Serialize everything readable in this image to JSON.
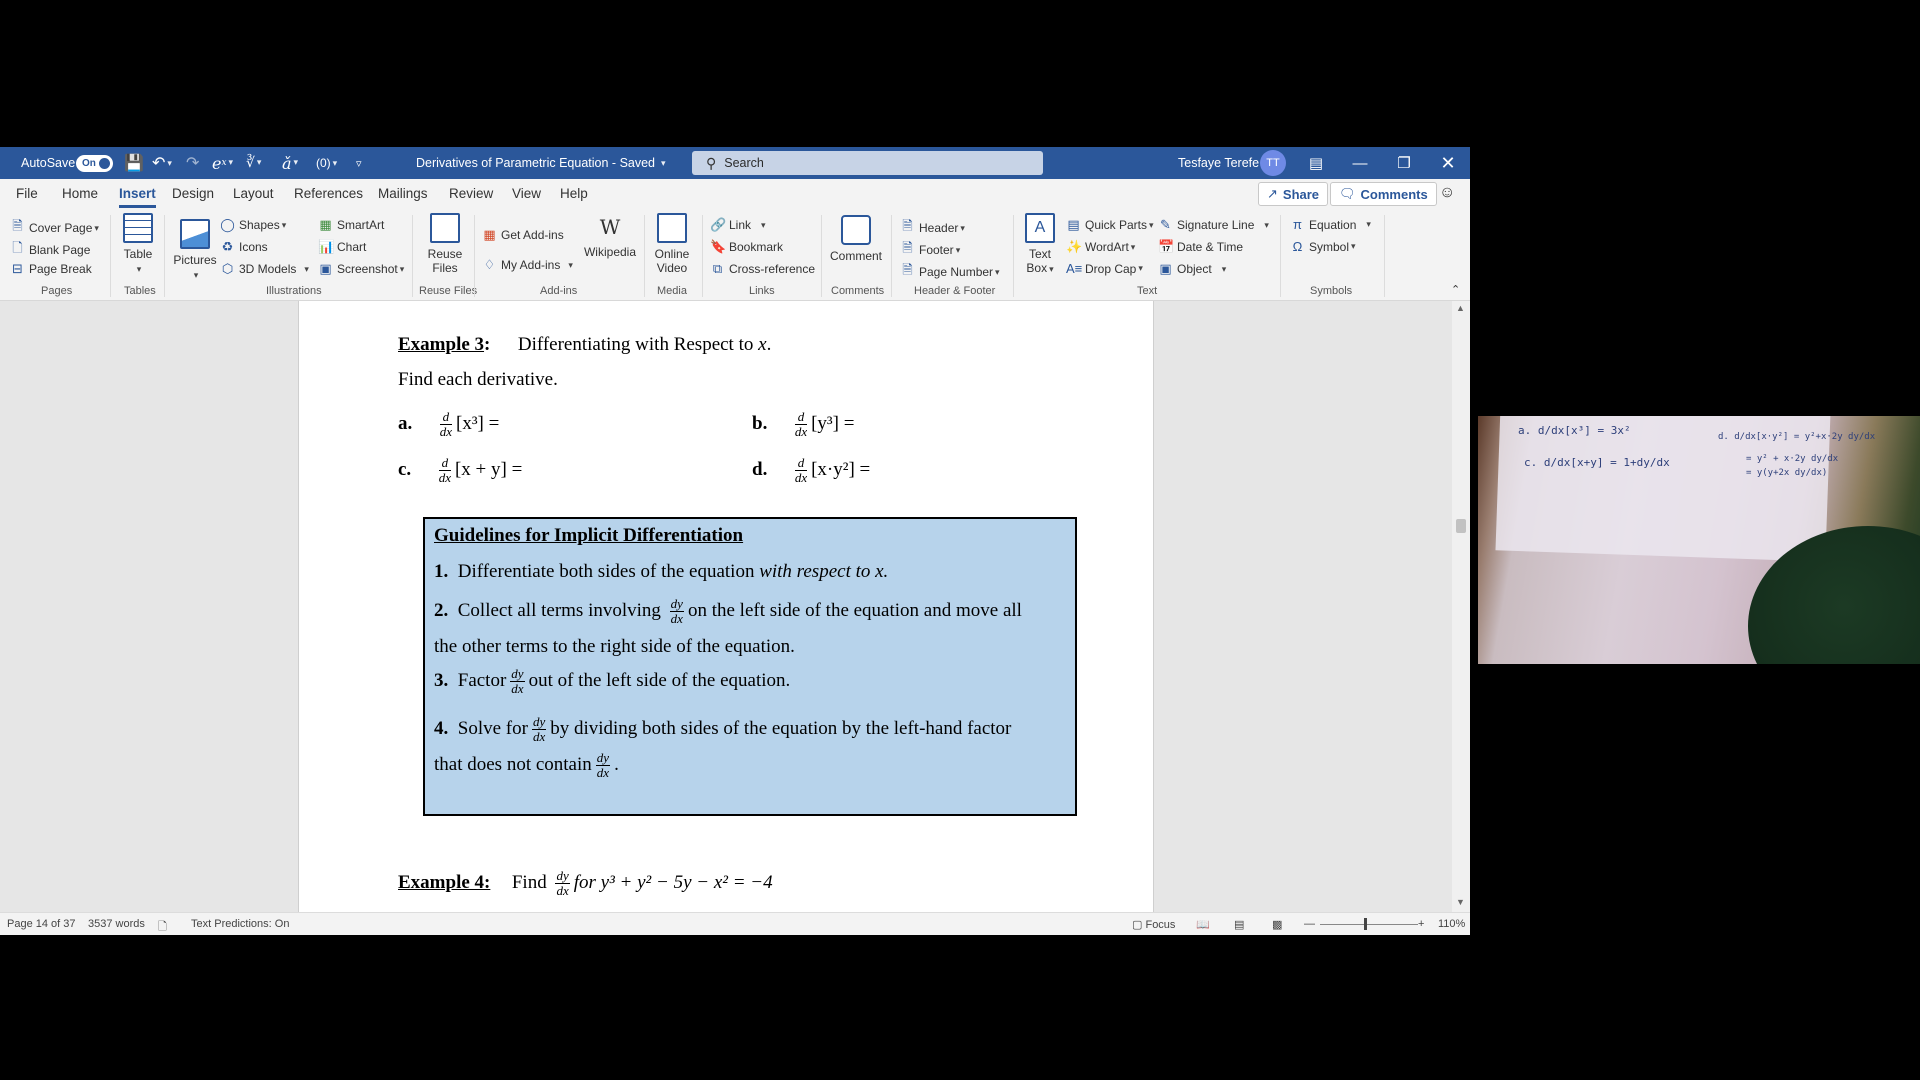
{
  "titlebar": {
    "autosave_label": "AutoSave",
    "autosave_state": "On",
    "doc_title": "Derivatives of Parametric Equation",
    "save_status": "Saved",
    "search_placeholder": "Search",
    "user_name": "Tesfaye Terefe",
    "user_initials": "TT"
  },
  "menu": {
    "tabs": [
      "File",
      "Home",
      "Insert",
      "Design",
      "Layout",
      "References",
      "Mailings",
      "Review",
      "View",
      "Help"
    ],
    "active_tab": "Insert",
    "share_label": "Share",
    "comments_label": "Comments"
  },
  "ribbon": {
    "pages": {
      "items": [
        "Cover Page",
        "Blank Page",
        "Page Break"
      ],
      "group": "Pages"
    },
    "tables": {
      "table": "Table",
      "group": "Tables"
    },
    "illustrations": {
      "pictures": "Pictures",
      "shapes": "Shapes",
      "icons": "Icons",
      "models": "3D Models",
      "smartart": "SmartArt",
      "chart": "Chart",
      "screenshot": "Screenshot",
      "group": "Illustrations"
    },
    "reuse": {
      "line1": "Reuse",
      "line2": "Files",
      "group": "Reuse Files"
    },
    "addins": {
      "get": "Get Add-ins",
      "my": "My Add-ins",
      "wikipedia": "Wikipedia",
      "group": "Add-ins"
    },
    "media": {
      "line1": "Online",
      "line2": "Video",
      "group": "Media"
    },
    "links": {
      "link": "Link",
      "bookmark": "Bookmark",
      "crossref": "Cross-reference",
      "group": "Links"
    },
    "comments": {
      "comment": "Comment",
      "group": "Comments"
    },
    "headerfooter": {
      "header": "Header",
      "footer": "Footer",
      "pagenumber": "Page Number",
      "group": "Header & Footer"
    },
    "text": {
      "textbox1": "Text",
      "textbox2": "Box",
      "quickparts": "Quick Parts",
      "wordart": "WordArt",
      "dropcap": "Drop Cap",
      "signature": "Signature Line",
      "datetime": "Date & Time",
      "object": "Object",
      "group": "Text"
    },
    "symbols": {
      "equation": "Equation",
      "symbol": "Symbol",
      "group": "Symbols"
    }
  },
  "document": {
    "example3_label": "Example 3",
    "example3_title": "Differentiating with Respect to",
    "example3_var": "x",
    "instruction": "Find each derivative.",
    "problems": [
      {
        "label": "a.",
        "expr": "[x³] ="
      },
      {
        "label": "b.",
        "expr": "[y³] ="
      },
      {
        "label": "c.",
        "expr": "[x + y] ="
      },
      {
        "label": "d.",
        "expr": "[x·y²] ="
      }
    ],
    "guidelines": {
      "title": "Guidelines for Implicit Differentiation",
      "step1_num": "1.",
      "step1_text": "Differentiate both sides of the equation",
      "step1_italic": "with respect to x.",
      "step2_num": "2.",
      "step2_a": "Collect all terms involving",
      "step2_b": "on the left side of the equation and move all",
      "step2_c": "the other terms to the right side of the equation.",
      "step3_num": "3.",
      "step3_a": "Factor",
      "step3_b": "out of the left side of the equation.",
      "step4_num": "4.",
      "step4_a": "Solve for",
      "step4_b": "by dividing both sides of the equation by the left-hand factor",
      "step4_c": "that does not contain"
    },
    "example4_label": "Example 4:",
    "example4_text": "Find",
    "example4_expr": "for y³ + y² − 5y − x² = −4",
    "frac_dx_num": "d",
    "frac_dx_den": "dx",
    "frac_dy_num": "dy",
    "frac_dy_den": "dx"
  },
  "statusbar": {
    "page": "Page 14 of 37",
    "words": "3537 words",
    "predictions": "Text Predictions: On",
    "focus": "Focus",
    "zoom": "110%"
  },
  "webcam": {
    "note1": "a. d/dx[x³] = 3x²",
    "note2": "c. d/dx[x+y] = 1+dy/dx",
    "note3": "d. d/dx[x·y²] = y²+x·2y dy/dx",
    "note4": "= y² + x·2y dy/dx",
    "note5": "= y(y+2x dy/dx)"
  }
}
